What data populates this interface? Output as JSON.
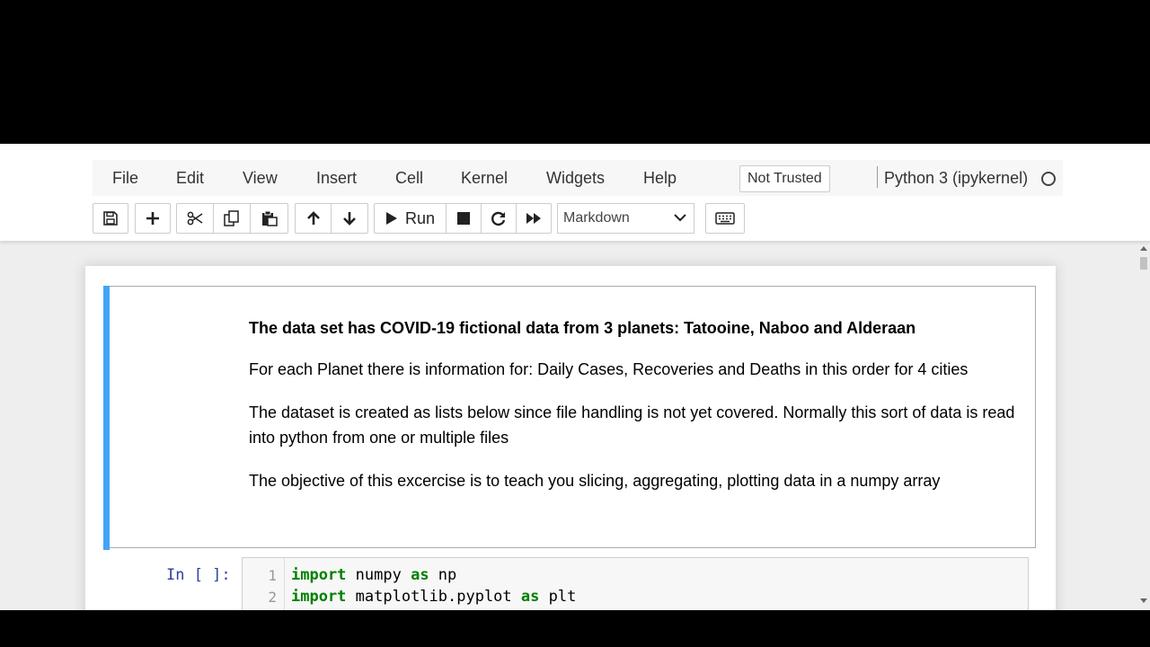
{
  "menu": {
    "items": [
      "File",
      "Edit",
      "View",
      "Insert",
      "Cell",
      "Kernel",
      "Widgets",
      "Help"
    ],
    "trust_status": "Not Trusted",
    "kernel_name": "Python 3 (ipykernel)",
    "kernel_indicator_icon": "kernel-idle-circle-icon"
  },
  "toolbar": {
    "save_icon": "save-icon",
    "insert_icon": "plus-icon",
    "cut_icon": "scissors-icon",
    "copy_icon": "copy-icon",
    "paste_icon": "paste-icon",
    "move_up_icon": "arrow-up-icon",
    "move_down_icon": "arrow-down-icon",
    "run_label": "Run",
    "cell_type": "Markdown",
    "keyboard_icon": "keyboard-icon"
  },
  "markdown_cell": {
    "title": "The data set has COVID-19 fictional data from 3 planets: Tatooine, Naboo and Alderaan",
    "paragraphs": [
      "For each Planet there is information for: Daily Cases, Recoveries and Deaths in this order for 4 cities",
      "The dataset is created as lists below since file handling is not yet covered. Normally this sort of data is read into python from one or multiple files",
      "The objective of this excercise is to teach you slicing, aggregating, plotting data in a numpy array"
    ]
  },
  "code_cell": {
    "prompt": "In [ ]:",
    "lines": [
      {
        "number": "1",
        "kw1": "import",
        "mod": " numpy ",
        "kw2": "as",
        "alias": " np"
      },
      {
        "number": "2",
        "kw1": "import",
        "mod": " matplotlib.pyplot ",
        "kw2": "as",
        "alias": " plt"
      }
    ]
  },
  "colors": {
    "selected_cell_bar": "#42a5f5",
    "prompt": "#303f9f",
    "keyword": "#008000"
  }
}
